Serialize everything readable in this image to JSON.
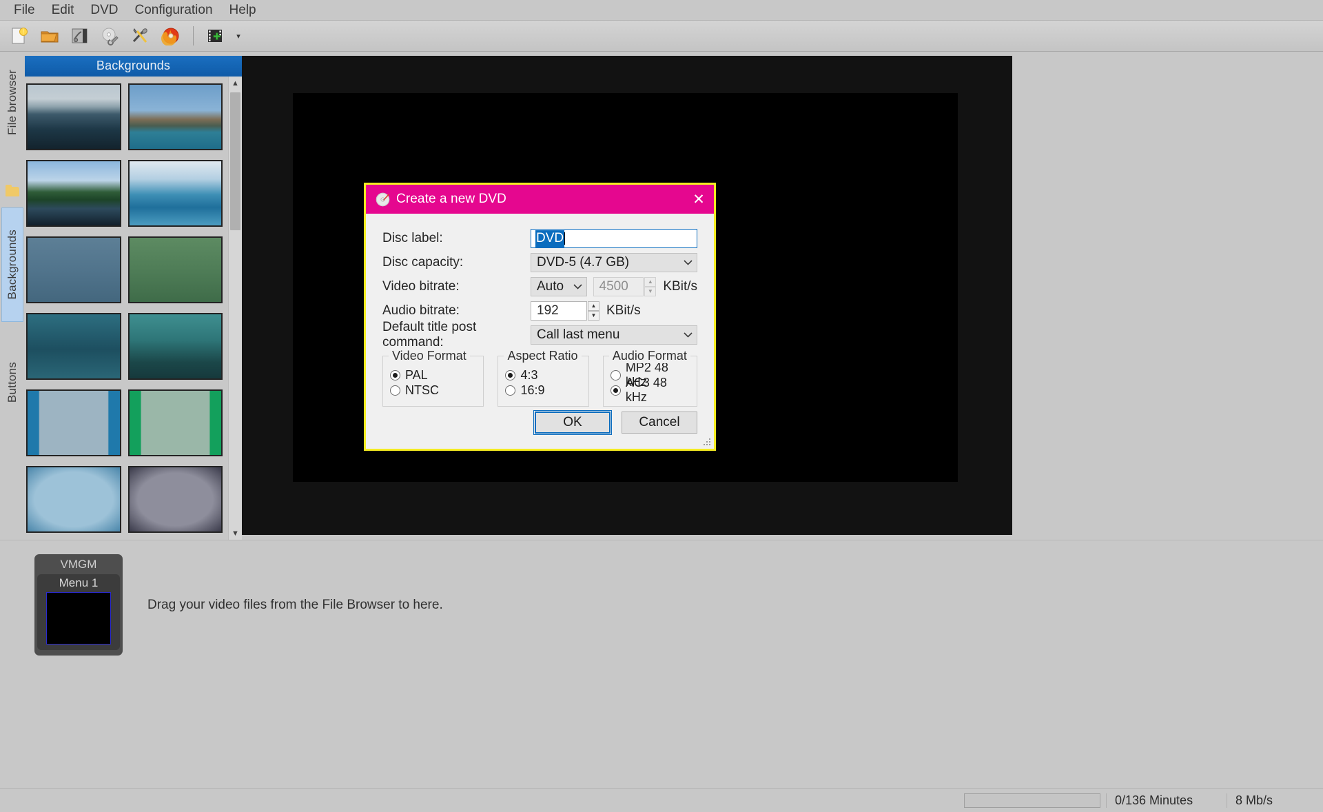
{
  "menubar": {
    "items": [
      {
        "label": "File"
      },
      {
        "label": "Edit"
      },
      {
        "label": "DVD"
      },
      {
        "label": "Configuration"
      },
      {
        "label": "Help"
      }
    ]
  },
  "toolbar": {
    "buttons": [
      {
        "name": "new-project-icon",
        "title": "New"
      },
      {
        "name": "open-project-icon",
        "title": "Open"
      },
      {
        "name": "save-project-icon",
        "title": "Save"
      },
      {
        "name": "settings-disc-icon",
        "title": "Disc settings"
      },
      {
        "name": "tools-icon",
        "title": "Tools"
      },
      {
        "name": "burn-disc-icon",
        "title": "Burn"
      },
      {
        "name": "add-video-icon",
        "title": "Add video"
      }
    ],
    "dropdown_caret": "▾"
  },
  "sidebar": {
    "tabs": [
      {
        "label": "File browser",
        "selected": false
      },
      {
        "label": "Backgrounds",
        "selected": true
      },
      {
        "label": "Buttons",
        "selected": false
      }
    ],
    "folder_icon": "folder-icon"
  },
  "browser": {
    "header": "Backgrounds",
    "scrollbar": {
      "up": "▲",
      "down": "▼"
    },
    "thumbnails": [
      {
        "name": "background-thumb-sea-island",
        "css": "linear-gradient(to bottom,#b9c6cf 0%,#c4ced4 22%,#8fa3ad 34%,#3d5a6b 46%,#1d3746 70%,#13232d 100%)"
      },
      {
        "name": "background-thumb-shipwreck",
        "css": "linear-gradient(to bottom,#6d9ec9 0%,#8ab3d6 40%,#7d6e56 54%,#4a5d50 64%,#2e7f96 74%,#1f6d8a 100%)"
      },
      {
        "name": "background-thumb-river-trees",
        "css": "linear-gradient(to bottom,#8cb6dd 0%,#bcd4e8 30%,#2f5c38 48%,#1d4428 60%,#2d4a5c 74%,#12202c 100%)"
      },
      {
        "name": "background-thumb-blue-hills",
        "css": "linear-gradient(to bottom,#dfe9f0 0%,#b3cfe2 28%,#3e8fb5 52%,#1f6f9b 72%,#4b9cc0 100%)"
      },
      {
        "name": "background-thumb-steel-blue",
        "css": "linear-gradient(to bottom,#5d7f96 0%,#51748c 50%,#44677e 100%)"
      },
      {
        "name": "background-thumb-moss-green",
        "css": "linear-gradient(to bottom,#5d8b62 0%,#4f7d57 50%,#3f6c49 100%)"
      },
      {
        "name": "background-thumb-teal-stripes",
        "css": "linear-gradient(to bottom,#2d6e80 0%,#1d4f60 55%,#2a6676 100%)"
      },
      {
        "name": "background-thumb-teal-clouds",
        "css": "linear-gradient(to bottom,#3f8f90 0%,#2e7678 40%,#1b4749 75%,#16393c 100%)"
      },
      {
        "name": "background-thumb-blue-bars",
        "css": "linear-gradient(to right,#1f79ab 0%,#1f79ab 12%,#9db4c2 13%,#9db4c2 87%,#1f79ab 88%,#1f79ab 100%)"
      },
      {
        "name": "background-thumb-green-bars",
        "css": "linear-gradient(to right,#13a05c 0%,#13a05c 12%,#9ab7a8 13%,#9ab7a8 87%,#13a05c 88%,#13a05c 100%)"
      },
      {
        "name": "background-thumb-blue-frame",
        "css": "radial-gradient(ellipse at center,#9dc2d8 0%,#9dc2d8 60%,#4a86aa 100%)"
      },
      {
        "name": "background-thumb-gray-frame",
        "css": "radial-gradient(ellipse at center,#8e8e9c 0%,#8e8e9c 58%,#3a3a4a 100%)"
      }
    ]
  },
  "menu_panel": {
    "vmgm_label": "VMGM",
    "menu_label": "Menu 1",
    "drop_hint": "Drag your video files from the File Browser to here."
  },
  "statusbar": {
    "minutes": "0/136 Minutes",
    "bitrate": "8 Mb/s"
  },
  "dialog": {
    "title": "Create a new DVD",
    "icon": "dvd-disc-icon",
    "close_label": "✕",
    "fields": {
      "disc_label": {
        "label": "Disc label:",
        "value": "DVD",
        "selected": true
      },
      "disc_capacity": {
        "label": "Disc capacity:",
        "value": "DVD-5 (4.7 GB)"
      },
      "video_bitrate": {
        "label": "Video bitrate:",
        "mode": "Auto",
        "value": "4500",
        "unit": "KBit/s",
        "disabled": true
      },
      "audio_bitrate": {
        "label": "Audio bitrate:",
        "value": "192",
        "unit": "KBit/s"
      },
      "default_title_post_command": {
        "label": "Default title post command:",
        "value": "Call last menu"
      }
    },
    "groups": [
      {
        "name": "video-format",
        "legend": "Video Format",
        "options": [
          {
            "label": "PAL",
            "checked": true
          },
          {
            "label": "NTSC",
            "checked": false
          }
        ]
      },
      {
        "name": "aspect-ratio",
        "legend": "Aspect Ratio",
        "options": [
          {
            "label": "4:3",
            "checked": true
          },
          {
            "label": "16:9",
            "checked": false
          }
        ]
      },
      {
        "name": "audio-format",
        "legend": "Audio Format",
        "options": [
          {
            "label": "MP2 48 kHz",
            "checked": false
          },
          {
            "label": "AC3 48 kHz",
            "checked": true
          }
        ]
      }
    ],
    "buttons": {
      "ok": "OK",
      "cancel": "Cancel"
    },
    "chevron": "⌄",
    "spin_up": "▲",
    "spin_down": "▼"
  },
  "colors": {
    "dialog_titlebar": "#e5078f",
    "dialog_border": "#f5ec22",
    "accent_blue": "#0a6cbe",
    "header_blue": "#1a6fc0",
    "window_bg": "#c8c8c8"
  }
}
